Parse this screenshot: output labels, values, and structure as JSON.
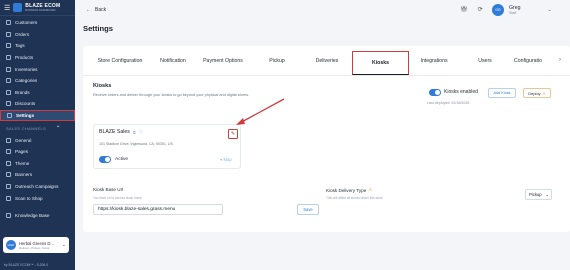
{
  "brand": {
    "title": "BLAZE ECOM",
    "subtitle": "BUSINESS DASHBOARD"
  },
  "sidebar": {
    "items": [
      {
        "label": "Customers",
        "icon": "users-icon"
      },
      {
        "label": "Orders",
        "icon": "orders-icon"
      },
      {
        "label": "Tags",
        "icon": "tag-icon"
      },
      {
        "label": "Products",
        "icon": "box-icon"
      },
      {
        "label": "Inventories",
        "icon": "inventory-icon"
      },
      {
        "label": "Categories",
        "icon": "category-icon"
      },
      {
        "label": "Brands",
        "icon": "brand-icon"
      },
      {
        "label": "Discounts",
        "icon": "discount-icon"
      },
      {
        "label": "Settings",
        "icon": "gear-icon",
        "active": true
      }
    ],
    "section_label": "SALES CHANNELS",
    "channel_items": [
      {
        "label": "General"
      },
      {
        "label": "Pages"
      },
      {
        "label": "Theme"
      },
      {
        "label": "Banners"
      },
      {
        "label": "Outreach Campaigns"
      },
      {
        "label": "Scan to Shop"
      }
    ],
    "knowledge_base": "Knowledge Base",
    "store": {
      "initials": "HGD",
      "name": "Herbal Greens D...",
      "meta": "Delivery, Pickup, Kiosk"
    },
    "footer": "by BLAZE ECOM™ - 5.206.0"
  },
  "header": {
    "back_label": "Back",
    "user_initials": "GR",
    "user_name": "Greg",
    "user_role": "Staff"
  },
  "page_title": "Settings",
  "tabs": [
    {
      "label": "Store Configuration"
    },
    {
      "label": "Notification"
    },
    {
      "label": "Payment Options"
    },
    {
      "label": "Pickup"
    },
    {
      "label": "Deliveries"
    },
    {
      "label": "Kiosks",
      "active": true
    },
    {
      "label": "Integrations"
    },
    {
      "label": "Users"
    },
    {
      "label": "Configuratio"
    }
  ],
  "kiosks": {
    "title": "Kiosks",
    "description": "Receive orders and deliver through your kiosks to go beyond your physical and digital stores.",
    "enabled_label": "Kiosks enabled",
    "last_deployed": "Last deployed: 02/18/2026",
    "add_button": "Add Kiosk",
    "deploy_button": "Deploy",
    "card": {
      "name": "BLAZE Sales",
      "address": "101 Stadium Drive, Inglewood, CA, 90301, US",
      "status": "Active",
      "map_label": "Map"
    },
    "base_url_label": "Kiosk Base Url",
    "base_url_hint": "You have url to access kiosk home",
    "base_url_value": "https://kiosk.blaze-sales.grass.menu",
    "save_button": "Save",
    "delivery_type_label": "Kiosk Delivery Type",
    "delivery_type_hint": "This will affect all kiosks under this store",
    "delivery_type_value": "Pickup"
  },
  "colors": {
    "sidebar_bg": "#1f3354",
    "accent": "#2f7bd8",
    "highlight": "#d23b3b"
  }
}
